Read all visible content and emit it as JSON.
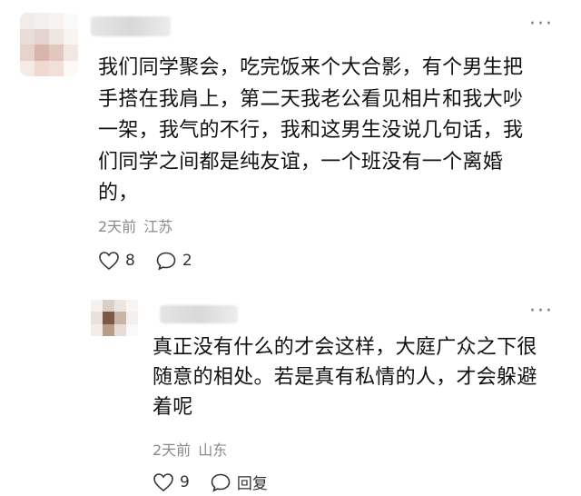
{
  "comment": {
    "text": "我们同学聚会，吃完饭来个大合影，有个男生把手搭在我肩上，第二天我老公看见相片和我大吵一架，我气的不行，我和这男生没说几句话，我们同学之间都是纯友谊，一个班没有一个离婚的，",
    "time": "2天前",
    "location": "江苏",
    "likes": "8",
    "replies": "2",
    "more_label": "···"
  },
  "reply": {
    "text": "真正没有什么的才会这样，大庭广众之下很随意的相处。若是真有私情的人，才会躲避着呢",
    "time": "2天前",
    "location": "山东",
    "likes": "9",
    "reply_label": "回复",
    "more_label": "···"
  },
  "icons": {
    "heart": "heart-icon",
    "comment": "comment-bubble-icon",
    "more": "more-dots-icon"
  },
  "colors": {
    "text": "#111111",
    "meta": "#8a8a8a",
    "icon": "#333333"
  }
}
